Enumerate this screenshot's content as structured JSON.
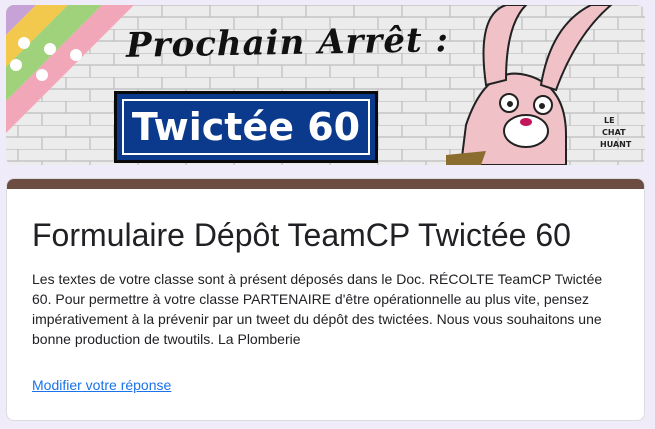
{
  "banner": {
    "title": "Prochain Arrêt :",
    "plate": "Twictée 60",
    "artist_signature": "LE CHAT HUANT",
    "colors": {
      "plate_bg": "#0b3a8c",
      "brick": "#ededed"
    }
  },
  "form": {
    "title": "Formulaire Dépôt TeamCP Twictée 60",
    "description": "Les textes de votre classe sont à présent déposés dans le Doc. RÉCOLTE TeamCP Twictée 60. Pour permettre à votre classe PARTENAIRE d'être opérationnelle au plus vite, pensez impérativement à la prévenir par un tweet du dépôt des twictées. Nous vous souhaitons une bonne production de twoutils. La Plomberie",
    "edit_link": "Modifier votre réponse",
    "colors": {
      "accent": "#6d4c41",
      "link": "#1a73e8",
      "page_bg": "#f0ebf8"
    }
  }
}
